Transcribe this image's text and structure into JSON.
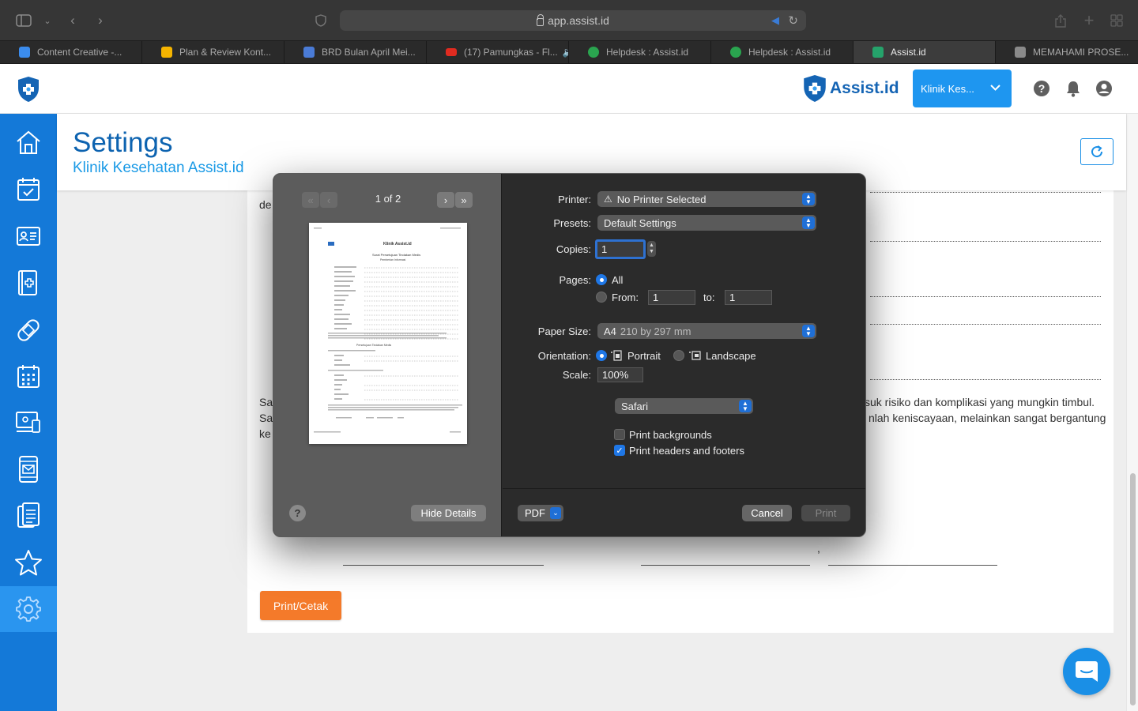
{
  "browser": {
    "url": "app.assist.id",
    "tabs": [
      {
        "label": "Content Creative -...",
        "favicon_color": "#3b8ced",
        "active": false
      },
      {
        "label": "Plan & Review Kont...",
        "favicon_color": "#f5b400",
        "active": false
      },
      {
        "label": "BRD Bulan April Mei...",
        "favicon_color": "#4a7bd6",
        "active": false
      },
      {
        "label": "(17) Pamungkas - Fl...",
        "favicon_color": "#e02b20",
        "active": false
      },
      {
        "label": "Helpdesk : Assist.id",
        "favicon_color": "#2aa44f",
        "active": false
      },
      {
        "label": "Helpdesk : Assist.id",
        "favicon_color": "#2aa44f",
        "active": false
      },
      {
        "label": "Assist.id",
        "favicon_color": "#25a36b",
        "active": true
      },
      {
        "label": "MEMAHAMI PROSE...",
        "favicon_color": "#8a8a8a",
        "active": false
      }
    ]
  },
  "app": {
    "brand": "Assist.id",
    "clinic_selector": "Klinik Kes...",
    "page_title": "Settings",
    "page_subtitle": "Klinik Kesehatan Assist.id",
    "sidebar": [
      {
        "name": "home-icon"
      },
      {
        "name": "calendar-check-icon"
      },
      {
        "name": "id-card-icon"
      },
      {
        "name": "medical-record-icon"
      },
      {
        "name": "bandage-icon"
      },
      {
        "name": "calendar-grid-icon"
      },
      {
        "name": "monitor-icon"
      },
      {
        "name": "mail-device-icon"
      },
      {
        "name": "clipboard-icon"
      },
      {
        "name": "star-icon"
      },
      {
        "name": "settings-gear-icon",
        "active": true
      }
    ]
  },
  "document": {
    "fragment_top": "de",
    "paragraph_line1_left": "Sa",
    "paragraph_line1_right": "suk risiko dan komplikasi yang mungkin timbul.",
    "paragraph_line2_left": "Sa",
    "paragraph_line2_right": "nlah keniscayaan, melainkan sangat bergantung",
    "paragraph_line3_left": "ke",
    "comma": ",",
    "print_button": "Print/Cetak"
  },
  "print_dialog": {
    "page_indicator": "1 of 2",
    "thumbnail": {
      "clinic": "Klinik Assist.id",
      "doc_title": "Surat Persetujuan Tindakan Medis",
      "section1": "Pemberian Informasi",
      "section2": "Persetujuan Tindakan Medis"
    },
    "labels": {
      "printer": "Printer:",
      "presets": "Presets:",
      "copies": "Copies:",
      "pages": "Pages:",
      "paper_size": "Paper Size:",
      "orientation": "Orientation:",
      "scale": "Scale:"
    },
    "printer_value": "No Printer Selected",
    "presets_value": "Default Settings",
    "copies_value": "1",
    "pages_all": "All",
    "pages_from_label": "From:",
    "pages_from_value": "1",
    "pages_to_label": "to:",
    "pages_to_value": "1",
    "paper_size_name": "A4",
    "paper_size_dims": "210 by 297 mm",
    "orientation_portrait": "Portrait",
    "orientation_landscape": "Landscape",
    "orientation_selected": "Portrait",
    "scale_value": "100%",
    "app_section": "Safari",
    "print_backgrounds_label": "Print backgrounds",
    "print_backgrounds_checked": false,
    "print_headers_label": "Print headers and footers",
    "print_headers_checked": true,
    "help": "?",
    "hide_details": "Hide Details",
    "pdf": "PDF",
    "cancel": "Cancel",
    "print": "Print"
  },
  "colors": {
    "sidebar": "#1479d8",
    "brand_blue": "#1464b4",
    "accent_orange": "#f47a2a",
    "mac_blue": "#1f77e6"
  }
}
